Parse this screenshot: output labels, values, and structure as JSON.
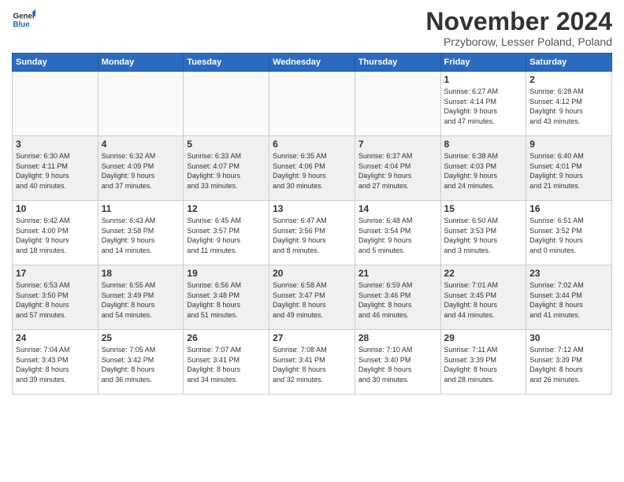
{
  "logo": {
    "line1": "General",
    "line2": "Blue"
  },
  "title": "November 2024",
  "subtitle": "Przyborow, Lesser Poland, Poland",
  "weekdays": [
    "Sunday",
    "Monday",
    "Tuesday",
    "Wednesday",
    "Thursday",
    "Friday",
    "Saturday"
  ],
  "weeks": [
    [
      {
        "day": "",
        "info": ""
      },
      {
        "day": "",
        "info": ""
      },
      {
        "day": "",
        "info": ""
      },
      {
        "day": "",
        "info": ""
      },
      {
        "day": "",
        "info": ""
      },
      {
        "day": "1",
        "info": "Sunrise: 6:27 AM\nSunset: 4:14 PM\nDaylight: 9 hours\nand 47 minutes."
      },
      {
        "day": "2",
        "info": "Sunrise: 6:28 AM\nSunset: 4:12 PM\nDaylight: 9 hours\nand 43 minutes."
      }
    ],
    [
      {
        "day": "3",
        "info": "Sunrise: 6:30 AM\nSunset: 4:11 PM\nDaylight: 9 hours\nand 40 minutes."
      },
      {
        "day": "4",
        "info": "Sunrise: 6:32 AM\nSunset: 4:09 PM\nDaylight: 9 hours\nand 37 minutes."
      },
      {
        "day": "5",
        "info": "Sunrise: 6:33 AM\nSunset: 4:07 PM\nDaylight: 9 hours\nand 33 minutes."
      },
      {
        "day": "6",
        "info": "Sunrise: 6:35 AM\nSunset: 4:06 PM\nDaylight: 9 hours\nand 30 minutes."
      },
      {
        "day": "7",
        "info": "Sunrise: 6:37 AM\nSunset: 4:04 PM\nDaylight: 9 hours\nand 27 minutes."
      },
      {
        "day": "8",
        "info": "Sunrise: 6:38 AM\nSunset: 4:03 PM\nDaylight: 9 hours\nand 24 minutes."
      },
      {
        "day": "9",
        "info": "Sunrise: 6:40 AM\nSunset: 4:01 PM\nDaylight: 9 hours\nand 21 minutes."
      }
    ],
    [
      {
        "day": "10",
        "info": "Sunrise: 6:42 AM\nSunset: 4:00 PM\nDaylight: 9 hours\nand 18 minutes."
      },
      {
        "day": "11",
        "info": "Sunrise: 6:43 AM\nSunset: 3:58 PM\nDaylight: 9 hours\nand 14 minutes."
      },
      {
        "day": "12",
        "info": "Sunrise: 6:45 AM\nSunset: 3:57 PM\nDaylight: 9 hours\nand 11 minutes."
      },
      {
        "day": "13",
        "info": "Sunrise: 6:47 AM\nSunset: 3:56 PM\nDaylight: 9 hours\nand 8 minutes."
      },
      {
        "day": "14",
        "info": "Sunrise: 6:48 AM\nSunset: 3:54 PM\nDaylight: 9 hours\nand 5 minutes."
      },
      {
        "day": "15",
        "info": "Sunrise: 6:50 AM\nSunset: 3:53 PM\nDaylight: 9 hours\nand 3 minutes."
      },
      {
        "day": "16",
        "info": "Sunrise: 6:51 AM\nSunset: 3:52 PM\nDaylight: 9 hours\nand 0 minutes."
      }
    ],
    [
      {
        "day": "17",
        "info": "Sunrise: 6:53 AM\nSunset: 3:50 PM\nDaylight: 8 hours\nand 57 minutes."
      },
      {
        "day": "18",
        "info": "Sunrise: 6:55 AM\nSunset: 3:49 PM\nDaylight: 8 hours\nand 54 minutes."
      },
      {
        "day": "19",
        "info": "Sunrise: 6:56 AM\nSunset: 3:48 PM\nDaylight: 8 hours\nand 51 minutes."
      },
      {
        "day": "20",
        "info": "Sunrise: 6:58 AM\nSunset: 3:47 PM\nDaylight: 8 hours\nand 49 minutes."
      },
      {
        "day": "21",
        "info": "Sunrise: 6:59 AM\nSunset: 3:46 PM\nDaylight: 8 hours\nand 46 minutes."
      },
      {
        "day": "22",
        "info": "Sunrise: 7:01 AM\nSunset: 3:45 PM\nDaylight: 8 hours\nand 44 minutes."
      },
      {
        "day": "23",
        "info": "Sunrise: 7:02 AM\nSunset: 3:44 PM\nDaylight: 8 hours\nand 41 minutes."
      }
    ],
    [
      {
        "day": "24",
        "info": "Sunrise: 7:04 AM\nSunset: 3:43 PM\nDaylight: 8 hours\nand 39 minutes."
      },
      {
        "day": "25",
        "info": "Sunrise: 7:05 AM\nSunset: 3:42 PM\nDaylight: 8 hours\nand 36 minutes."
      },
      {
        "day": "26",
        "info": "Sunrise: 7:07 AM\nSunset: 3:41 PM\nDaylight: 8 hours\nand 34 minutes."
      },
      {
        "day": "27",
        "info": "Sunrise: 7:08 AM\nSunset: 3:41 PM\nDaylight: 8 hours\nand 32 minutes."
      },
      {
        "day": "28",
        "info": "Sunrise: 7:10 AM\nSunset: 3:40 PM\nDaylight: 8 hours\nand 30 minutes."
      },
      {
        "day": "29",
        "info": "Sunrise: 7:11 AM\nSunset: 3:39 PM\nDaylight: 8 hours\nand 28 minutes."
      },
      {
        "day": "30",
        "info": "Sunrise: 7:12 AM\nSunset: 3:39 PM\nDaylight: 8 hours\nand 26 minutes."
      }
    ]
  ]
}
